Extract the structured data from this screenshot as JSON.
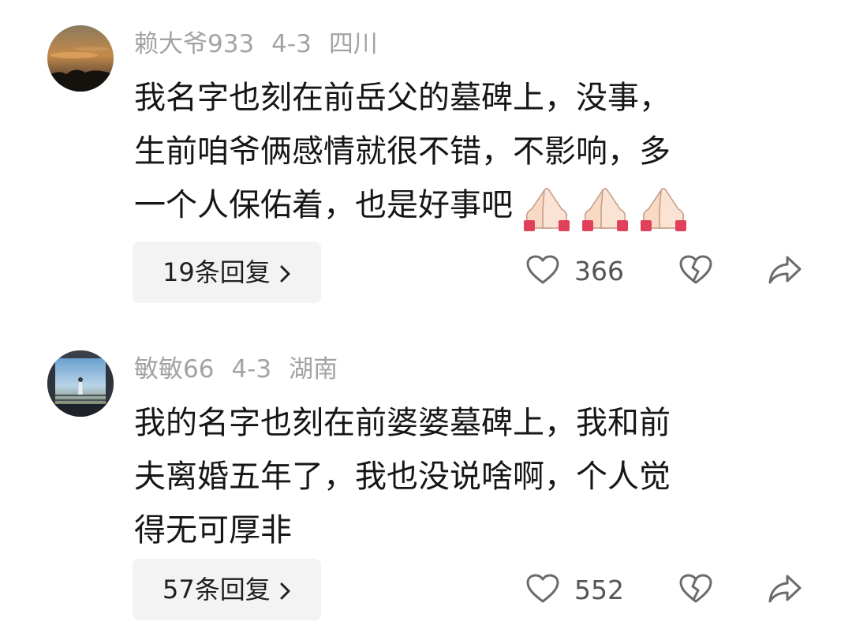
{
  "comments": [
    {
      "username": "赖大爷933",
      "date": "4-3",
      "location": "四川",
      "lines": [
        "我名字也刻在前岳父的墓碑上，没事，",
        "生前咱爷俩感情就很不错，不影响，多",
        "一个人保佑着，也是好事吧"
      ],
      "emoji": [
        "🙏",
        "🙏",
        "🙏"
      ],
      "reply_label": "19条回复",
      "like_count": "366",
      "icons": [
        "heart-icon",
        "broken-heart-icon",
        "share-icon",
        "chevron-right-icon"
      ]
    },
    {
      "username": "敏敏66",
      "date": "4-3",
      "location": "湖南",
      "lines": [
        "我的名字也刻在前婆婆墓碑上，我和前",
        "夫离婚五年了，我也没说啥啊，个人觉",
        "得无可厚非"
      ],
      "reply_label": "57条回复",
      "like_count": "552",
      "icons": [
        "heart-icon",
        "broken-heart-icon",
        "share-icon",
        "chevron-right-icon"
      ]
    }
  ],
  "colors": {
    "meta_text": "#a3a3a3",
    "body_text": "#161616",
    "reply_bg": "#f3f3f3",
    "icon_stroke": "#6b6b6b",
    "emoji_skin": "#f8d9c4",
    "emoji_cuff": "#e0405a"
  }
}
